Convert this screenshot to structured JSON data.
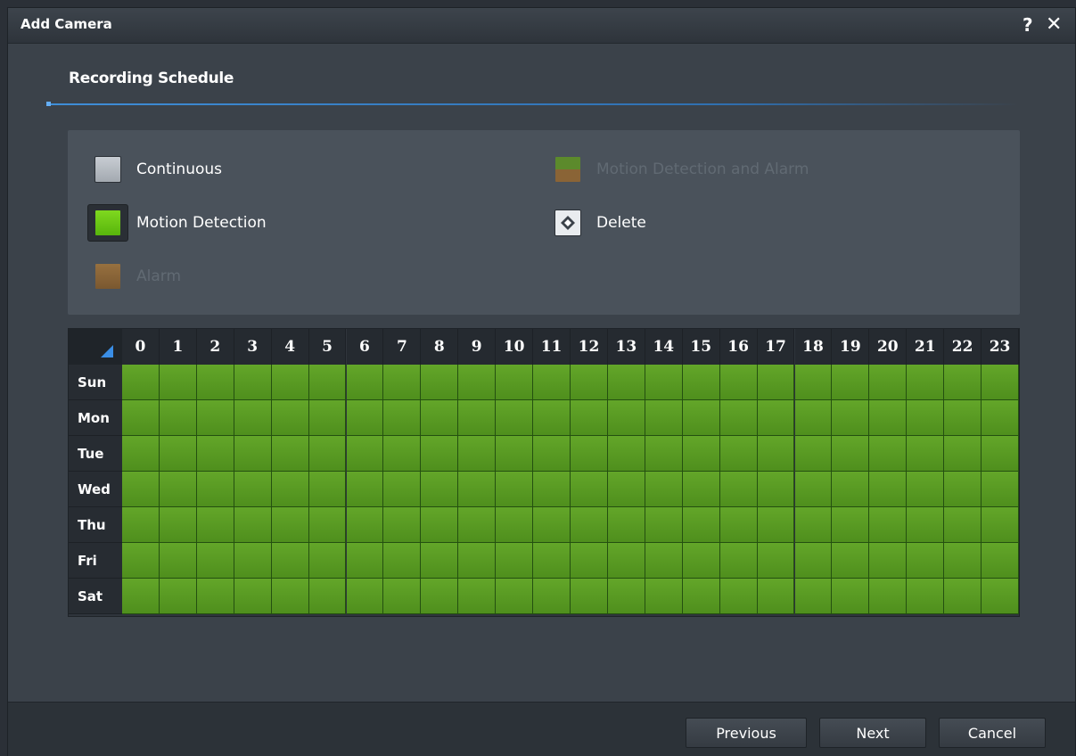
{
  "window": {
    "title": "Add Camera",
    "help_label": "?",
    "close_label": "✕"
  },
  "section": {
    "title": "Recording Schedule"
  },
  "legend": [
    {
      "label": "Continuous",
      "color": "#b6bcc3",
      "enabled": true,
      "selected": false
    },
    {
      "label": "Motion Detection",
      "color": "#6ccb16",
      "enabled": true,
      "selected": true
    },
    {
      "label": "Alarm",
      "color": "#8a6436",
      "enabled": false,
      "selected": false
    },
    {
      "label": "Motion Detection and Alarm",
      "color": "#5d7a38",
      "enabled": false,
      "selected": false
    },
    {
      "label": "Delete",
      "icon": "eraser-icon",
      "enabled": true,
      "selected": false
    }
  ],
  "schedule": {
    "hours": [
      "0",
      "1",
      "2",
      "3",
      "4",
      "5",
      "6",
      "7",
      "8",
      "9",
      "10",
      "11",
      "12",
      "13",
      "14",
      "15",
      "16",
      "17",
      "18",
      "19",
      "20",
      "21",
      "22",
      "23"
    ],
    "days": [
      "Sun",
      "Mon",
      "Tue",
      "Wed",
      "Thu",
      "Fri",
      "Sat"
    ],
    "mode_per_cell": "Motion Detection",
    "cell_color": "#5a9b22"
  },
  "footer": {
    "previous_label": "Previous",
    "next_label": "Next",
    "cancel_label": "Cancel"
  }
}
